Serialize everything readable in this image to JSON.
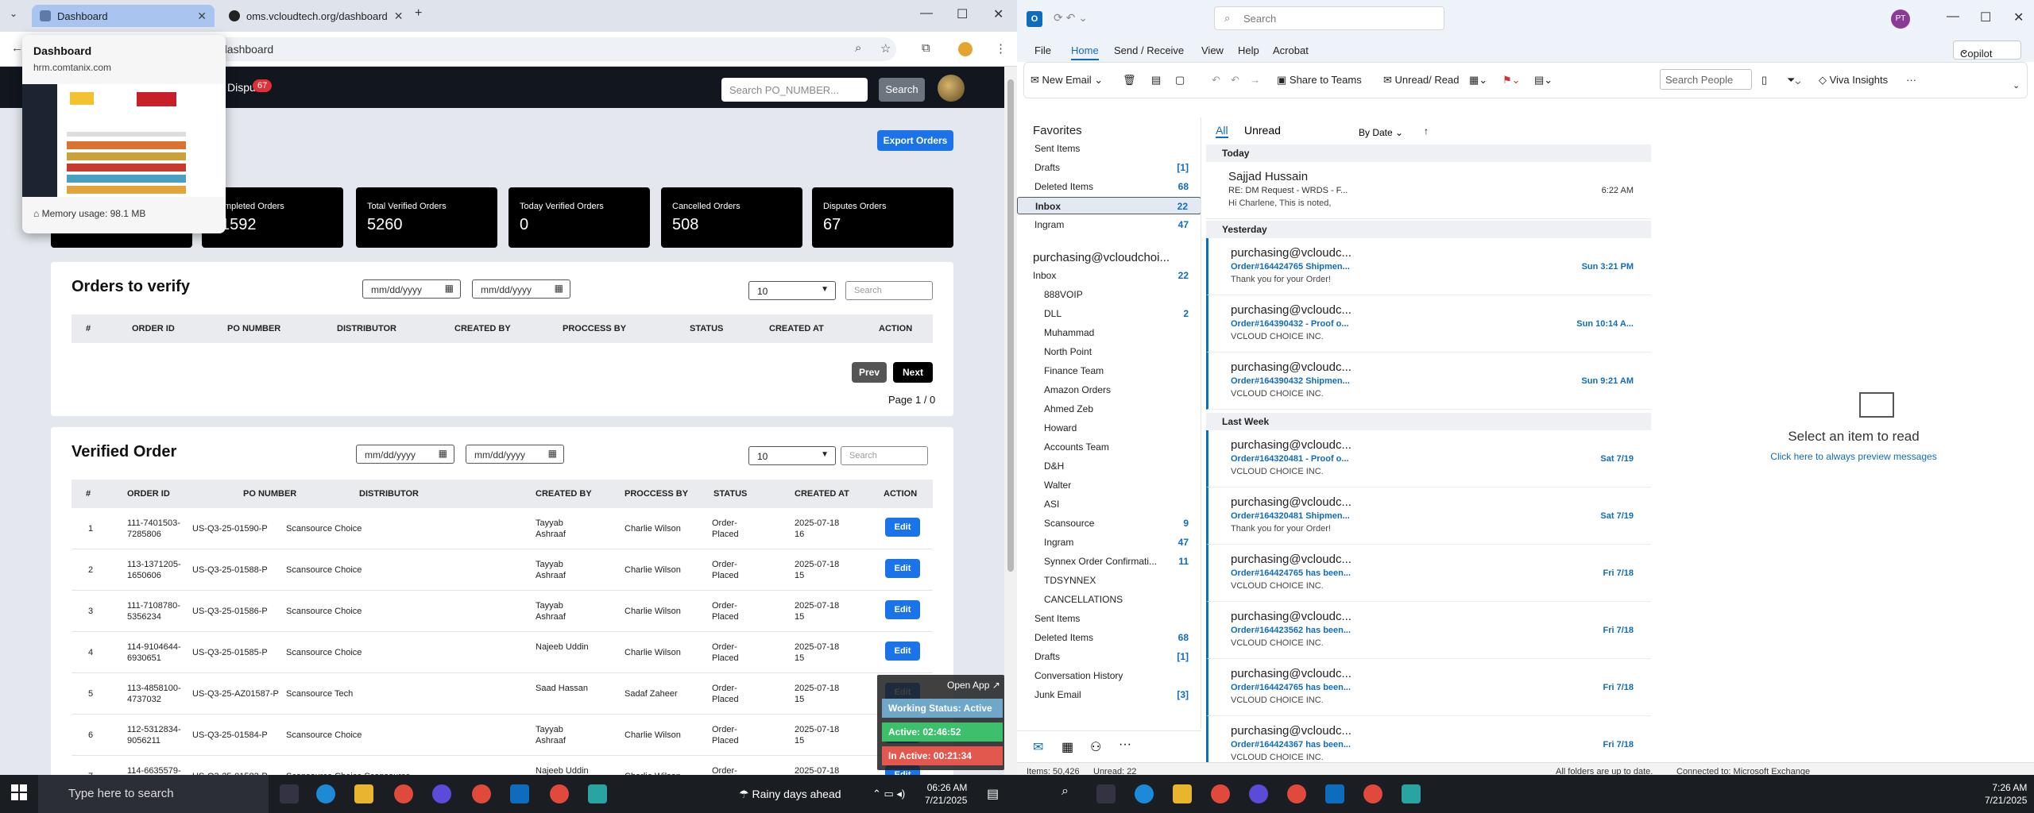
{
  "chrome": {
    "tab1_title": "Dashboard",
    "tab2_title": "oms.vcloudtech.org/dashboard",
    "address": "dashboard",
    "hover_title": "Dashboard",
    "hover_url": "hrm.comtanix.com",
    "memory": "Memory usage: 98.1 MB"
  },
  "app": {
    "nav_disputes": "Dispu",
    "nav_badge": "67",
    "search_placeholder": "Search PO_NUMBER...",
    "search_button": "Search",
    "export_button": "Export Orders",
    "cards": [
      {
        "label": "mpleted Orders",
        "value": "1592"
      },
      {
        "label": "Total Verified Orders",
        "value": "5260"
      },
      {
        "label": "Today Verified Orders",
        "value": "0"
      },
      {
        "label": "Cancelled Orders",
        "value": "508"
      },
      {
        "label": "Disputes Orders",
        "value": "67"
      }
    ],
    "verify": {
      "title": "Orders to verify",
      "date_placeholder": "mm/dd/yyyy",
      "page_size": "10",
      "search_placeholder": "Search",
      "headers": [
        "#",
        "ORDER ID",
        "PO NUMBER",
        "DISTRIBUTOR",
        "CREATED BY",
        "PROCCESS BY",
        "STATUS",
        "CREATED AT",
        "ACTION"
      ],
      "prev": "Prev",
      "next": "Next",
      "page_info": "Page 1 / 0"
    },
    "verified": {
      "title": "Verified Order",
      "date_placeholder": "mm/dd/yyyy",
      "page_size": "10",
      "search_placeholder": "Search",
      "headers": [
        "#",
        "ORDER ID",
        "PO NUMBER",
        "DISTRIBUTOR",
        "CREATED BY",
        "PROCCESS BY",
        "STATUS",
        "CREATED AT",
        "ACTION"
      ],
      "rows": [
        {
          "idx": "1",
          "oid": "111-7401503-7285806",
          "po": "US-Q3-25-01590-P",
          "dist": "Scansource Choice",
          "by": "Tayyab Ashraaf",
          "proc": "Charlie Wilson",
          "status": "Order-Placed",
          "at": "2025-07-18 16",
          "action": "Edit"
        },
        {
          "idx": "2",
          "oid": "113-1371205-1650606",
          "po": "US-Q3-25-01588-P",
          "dist": "Scansource Choice",
          "by": "Tayyab Ashraaf",
          "proc": "Charlie Wilson",
          "status": "Order-Placed",
          "at": "2025-07-18 15",
          "action": "Edit"
        },
        {
          "idx": "3",
          "oid": "111-7108780-5356234",
          "po": "US-Q3-25-01586-P",
          "dist": "Scansource Choice",
          "by": "Tayyab Ashraaf",
          "proc": "Charlie Wilson",
          "status": "Order-Placed",
          "at": "2025-07-18 15",
          "action": "Edit"
        },
        {
          "idx": "4",
          "oid": "114-9104644-6930651",
          "po": "US-Q3-25-01585-P",
          "dist": "Scansource Choice",
          "by": "Najeeb Uddin",
          "proc": "Charlie Wilson",
          "status": "Order-Placed",
          "at": "2025-07-18 15",
          "action": "Edit"
        },
        {
          "idx": "5",
          "oid": "113-4858100-4737032",
          "po": "US-Q3-25-AZ01587-P",
          "dist": "Scansource Tech",
          "by": "Saad Hassan",
          "proc": "Sadaf Zaheer",
          "status": "Order-Placed",
          "at": "2025-07-18 15",
          "action": "Edit"
        },
        {
          "idx": "6",
          "oid": "112-5312834-9056211",
          "po": "US-Q3-25-01584-P",
          "dist": "Scansource Choice",
          "by": "Tayyab Ashraaf",
          "proc": "Charlie Wilson",
          "status": "Order-Placed",
          "at": "2025-07-18 15",
          "action": "Edit"
        },
        {
          "idx": "7",
          "oid": "114-6635579-",
          "po": "US-Q3-25-01582-P",
          "dist": "Scansource Choice Scansource",
          "by": "Najeeb Uddin",
          "proc": "Charlie Wilson",
          "status": "Order-",
          "at": "2025-07-18",
          "action": "Edit"
        }
      ]
    },
    "status_widget": {
      "open_app": "Open App ↗",
      "working": "Working Status: Active",
      "active": "Active: 02:46:52",
      "inactive": "In Active: 00:21:34"
    }
  },
  "taskbar": {
    "search_placeholder": "Type here to search",
    "weather": "Rainy days ahead",
    "time": "06:26 AM",
    "date": "7/21/2025"
  },
  "outlook": {
    "search_placeholder": "Search",
    "avatar": "PT",
    "menu": [
      "File",
      "Home",
      "Send / Receive",
      "View",
      "Help",
      "Acrobat"
    ],
    "copilot": "Copilot",
    "ribbon": {
      "new_email": "New Email",
      "share_teams": "Share to Teams",
      "unread_read": "Unread/ Read",
      "search_people": "Search People",
      "viva": "Viva Insights"
    },
    "folders": {
      "favorites": "Favorites",
      "fav_items": [
        {
          "name": "Sent Items",
          "count": ""
        },
        {
          "name": "Drafts",
          "count": "[1]"
        },
        {
          "name": "Deleted Items",
          "count": "68"
        },
        {
          "name": "Inbox",
          "count": "22"
        },
        {
          "name": "Ingram",
          "count": "47"
        }
      ],
      "account": "purchasing@vcloudchoi...",
      "inbox": "Inbox",
      "inbox_count": "22",
      "subfolders": [
        {
          "name": "888VOIP",
          "count": ""
        },
        {
          "name": "DLL",
          "count": "2"
        },
        {
          "name": "Muhammad",
          "count": ""
        },
        {
          "name": "North Point",
          "count": ""
        },
        {
          "name": "Finance Team",
          "count": ""
        },
        {
          "name": "Amazon Orders",
          "count": ""
        },
        {
          "name": "Ahmed Zeb",
          "count": ""
        },
        {
          "name": "Howard",
          "count": ""
        },
        {
          "name": "Accounts Team",
          "count": ""
        },
        {
          "name": "D&H",
          "count": ""
        },
        {
          "name": "Walter",
          "count": ""
        },
        {
          "name": "ASI",
          "count": ""
        },
        {
          "name": "Scansource",
          "count": "9"
        },
        {
          "name": "Ingram",
          "count": "47"
        },
        {
          "name": "Synnex Order Confirmati...",
          "count": "11"
        },
        {
          "name": "TDSYNNEX",
          "count": ""
        }
      ],
      "cancellations": "CANCELLATIONS",
      "lower": [
        {
          "name": "Sent Items",
          "count": ""
        },
        {
          "name": "Deleted Items",
          "count": "68"
        },
        {
          "name": "Drafts",
          "count": "[1]"
        },
        {
          "name": "Conversation History",
          "count": ""
        },
        {
          "name": "Junk Email",
          "count": "[3]"
        }
      ]
    },
    "list": {
      "all": "All",
      "unread": "Unread",
      "by_date": "By Date",
      "groups": {
        "today": "Today",
        "yesterday": "Yesterday",
        "last_week": "Last Week"
      },
      "messages": [
        {
          "from": "Sajjad Hussain",
          "subj": "RE: DM Request - WRDS - F...",
          "date": "6:22 AM",
          "prev": "Hi Charlene,   This is noted,"
        },
        {
          "from": "purchasing@vcloudc...",
          "subj": "Order#164424765 Shipmen...",
          "date": "Sun 3:21 PM",
          "prev": "Thank you for your Order!"
        },
        {
          "from": "purchasing@vcloudc...",
          "subj": "Order#164390432 - Proof o...",
          "date": "Sun 10:14 A...",
          "prev": "VCLOUD CHOICE INC."
        },
        {
          "from": "purchasing@vcloudc...",
          "subj": "Order#164390432 Shipmen...",
          "date": "Sun 9:21 AM",
          "prev": "VCLOUD CHOICE INC."
        },
        {
          "from": "purchasing@vcloudc...",
          "subj": "Order#164320481 - Proof o...",
          "date": "Sat 7/19",
          "prev": "VCLOUD CHOICE INC."
        },
        {
          "from": "purchasing@vcloudc...",
          "subj": "Order#164320481 Shipmen...",
          "date": "Sat 7/19",
          "prev": "Thank you for your Order!"
        },
        {
          "from": "purchasing@vcloudc...",
          "subj": "Order#164424765 has been...",
          "date": "Fri 7/18",
          "prev": "VCLOUD CHOICE INC."
        },
        {
          "from": "purchasing@vcloudc...",
          "subj": "Order#164423562 has been...",
          "date": "Fri 7/18",
          "prev": "VCLOUD CHOICE INC."
        },
        {
          "from": "purchasing@vcloudc...",
          "subj": "Order#164424765 has been...",
          "date": "Fri 7/18",
          "prev": "VCLOUD CHOICE INC."
        },
        {
          "from": "purchasing@vcloudc...",
          "subj": "Order#164424367 has been...",
          "date": "Fri 7/18",
          "prev": "VCLOUD CHOICE INC."
        }
      ]
    },
    "reading": {
      "select": "Select an item to read",
      "link": "Click here to always preview messages"
    },
    "status": {
      "items": "Items: 50,426",
      "unread": "Unread: 22",
      "folders": "All folders are up to date.",
      "connected": "Connected to: Microsoft Exchange"
    }
  },
  "taskbar2": {
    "time": "7:26 AM",
    "date": "7/21/2025"
  }
}
